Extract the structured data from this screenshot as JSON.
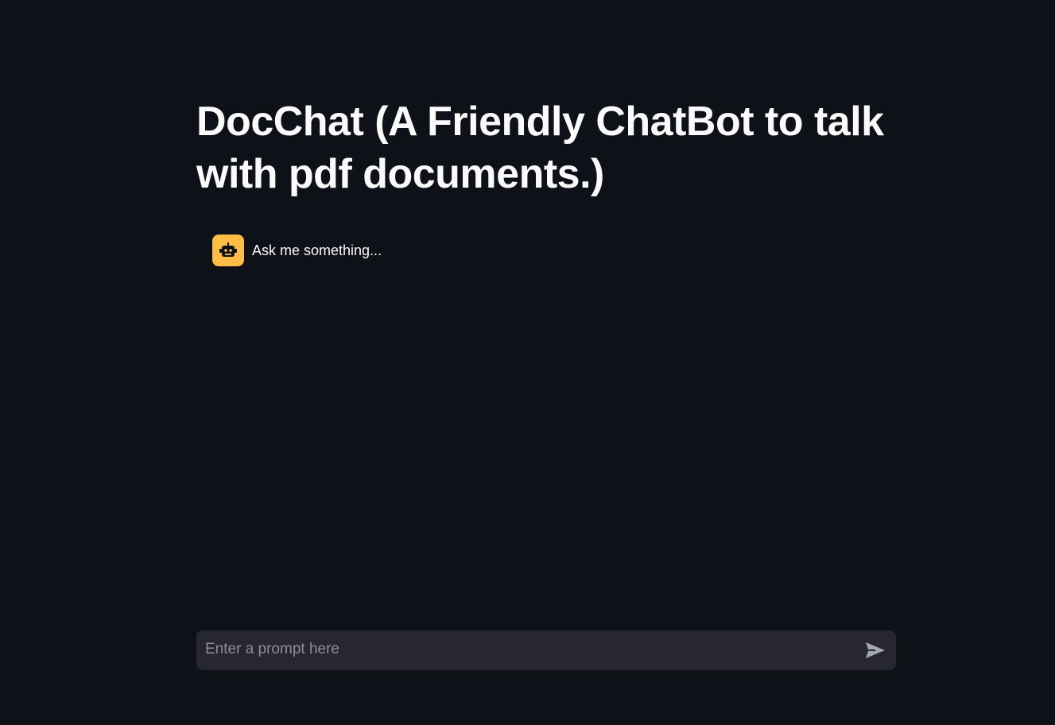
{
  "page": {
    "title": "DocChat (A Friendly ChatBot to talk with pdf documents.)"
  },
  "chat": {
    "messages": [
      {
        "role": "assistant",
        "avatar_icon": "robot-icon",
        "text": "Ask me something..."
      }
    ]
  },
  "input": {
    "placeholder": "Enter a prompt here",
    "value": "",
    "send_icon": "send-icon"
  },
  "colors": {
    "background": "#0e1117",
    "avatar_background": "#ffbd45",
    "input_background": "#262730",
    "text": "#fafafa",
    "placeholder": "#8b8e98"
  }
}
